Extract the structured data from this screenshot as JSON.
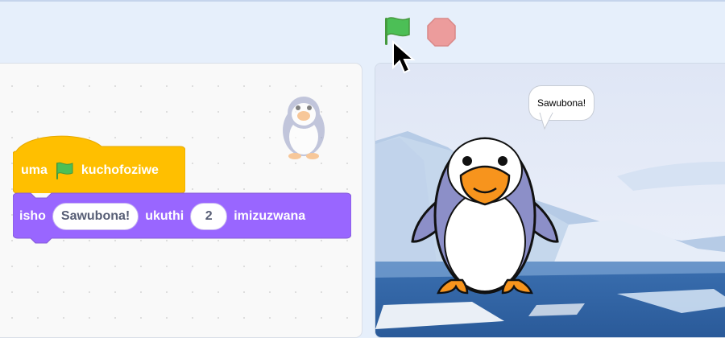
{
  "toolbar": {
    "green_flag_icon": "green-flag-icon",
    "stop_icon": "stop-icon",
    "colors": {
      "flag": "#4cbf56",
      "stop": "#ec9c9c"
    }
  },
  "code": {
    "hat_block": {
      "prefix": "uma",
      "icon": "green-flag-icon",
      "suffix": "kuchofoziwe",
      "color": "#ffbf00"
    },
    "say_block": {
      "word_say": "isho",
      "message": "Sawubona!",
      "word_for": "ukuthi",
      "seconds": "2",
      "word_seconds": "imizuzwana",
      "color": "#9966ff"
    }
  },
  "stage": {
    "speech_text": "Sawubona!"
  }
}
